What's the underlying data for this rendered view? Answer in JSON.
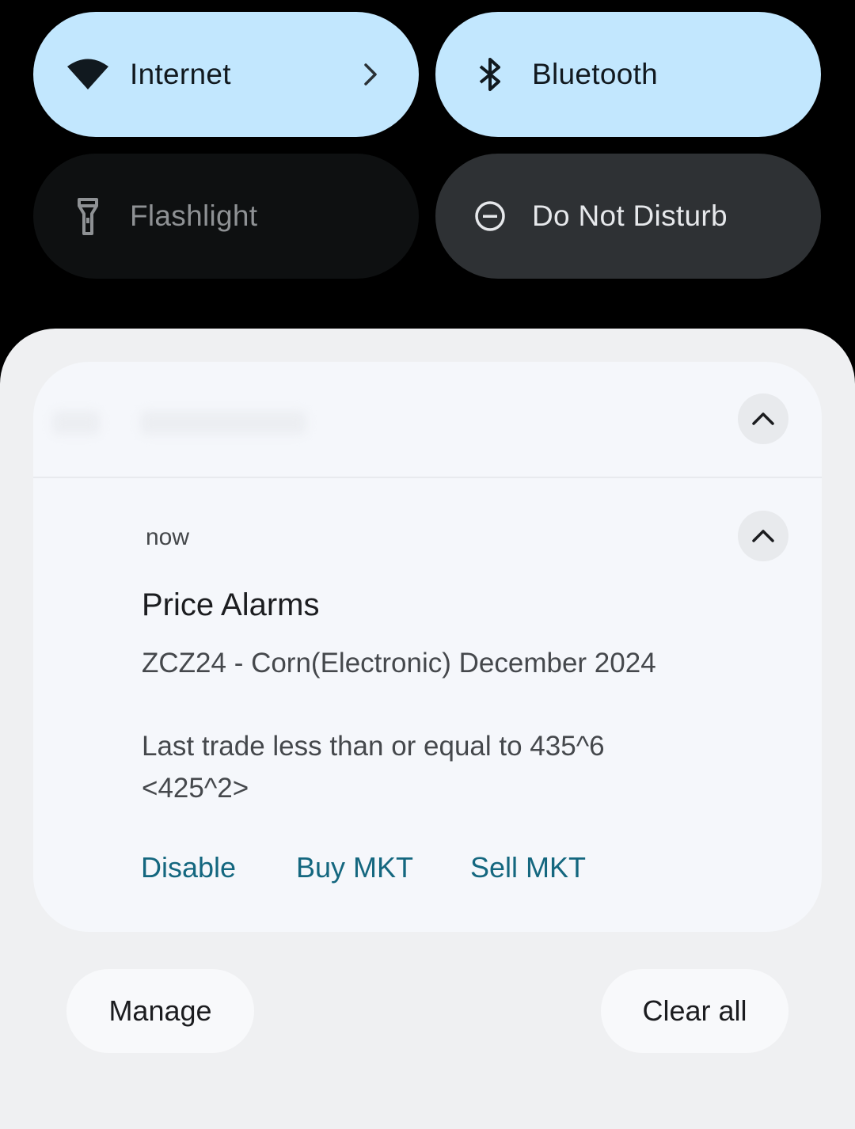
{
  "quick_settings": {
    "internet": {
      "label": "Internet",
      "icon": "wifi-icon",
      "state": "on"
    },
    "bluetooth": {
      "label": "Bluetooth",
      "icon": "bluetooth-icon",
      "state": "on"
    },
    "flashlight": {
      "label": "Flashlight",
      "icon": "flashlight-icon",
      "state": "off"
    },
    "dnd": {
      "label": "Do Not Disturb",
      "icon": "do-not-disturb-icon",
      "state": "off"
    }
  },
  "notification": {
    "time": "now",
    "title": "Price Alarms",
    "line1": "ZCZ24 - Corn(Electronic) December 2024",
    "line2": "Last trade less than or equal to 435^6",
    "line3": "<425^2>",
    "actions": {
      "disable": "Disable",
      "buy": "Buy MKT",
      "sell": "Sell MKT"
    }
  },
  "footer": {
    "manage": "Manage",
    "clear_all": "Clear all"
  },
  "colors": {
    "tile_on": "#c2e7fe",
    "tile_off": "#0e1011",
    "tile_dnd": "#2e3134",
    "action_link": "#14677f",
    "shade_bg": "#eff0f2",
    "card_bg": "#f5f7fb"
  }
}
